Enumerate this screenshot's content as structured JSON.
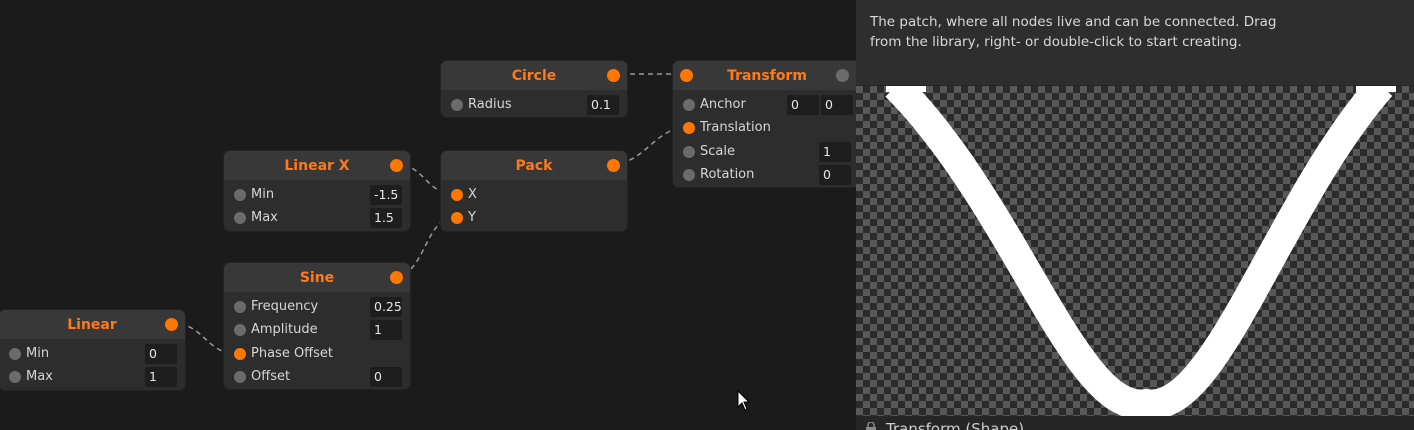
{
  "nodes": {
    "circle": {
      "title": "Circle",
      "radius_label": "Radius",
      "radius_value": "0.1"
    },
    "transform": {
      "title": "Transform",
      "anchor_label": "Anchor",
      "anchor_x": "0",
      "anchor_y": "0",
      "translation_label": "Translation",
      "scale_label": "Scale",
      "scale_value": "1",
      "rotation_label": "Rotation",
      "rotation_value": "0"
    },
    "linear_x": {
      "title": "Linear X",
      "min_label": "Min",
      "min_value": "-1.5",
      "max_label": "Max",
      "max_value": "1.5"
    },
    "pack": {
      "title": "Pack",
      "x_label": "X",
      "y_label": "Y"
    },
    "sine": {
      "title": "Sine",
      "frequency_label": "Frequency",
      "frequency_value": "0.25",
      "amplitude_label": "Amplitude",
      "amplitude_value": "1",
      "phase_label": "Phase Offset",
      "offset_label": "Offset",
      "offset_value": "0"
    },
    "linear": {
      "title": "Linear",
      "min_label": "Min",
      "min_value": "0",
      "max_label": "Max",
      "max_value": "1"
    }
  },
  "info": {
    "text": "The patch, where all nodes live and can be connected. Drag from the library, right- or double-click to start creating."
  },
  "footer": {
    "label": "Transform (Shape)"
  },
  "colors": {
    "accent": "#ff7700",
    "node_bg": "#2d2d2d",
    "header_bg": "#383838",
    "canvas_bg": "#1b1b1b"
  },
  "icons": {
    "cursor": "arrow-cursor-icon",
    "lock": "lock-icon"
  }
}
